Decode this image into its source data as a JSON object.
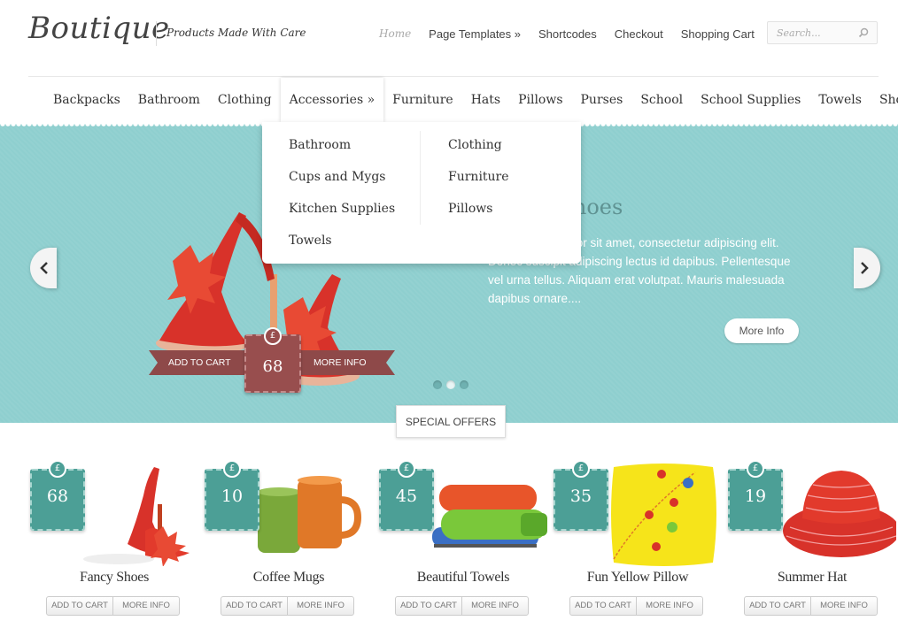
{
  "header": {
    "logo": "Boutique",
    "tagline": "Products Made With Care",
    "top_nav": [
      {
        "label": "Home",
        "active": true
      },
      {
        "label": "Page Templates »",
        "active": false
      },
      {
        "label": "Shortcodes",
        "active": false
      },
      {
        "label": "Checkout",
        "active": false
      },
      {
        "label": "Shopping Cart",
        "active": false
      }
    ],
    "search_placeholder": "Search..."
  },
  "categories": [
    "Backpacks",
    "Bathroom",
    "Clothing",
    "Accessories »",
    "Furniture",
    "Hats",
    "Pillows",
    "Purses",
    "School",
    "School Supplies",
    "Towels",
    "Shoes"
  ],
  "dropdown": {
    "column1": [
      "Bathroom",
      "Cups and Mygs",
      "Kitchen Supplies",
      "Towels"
    ],
    "column2": [
      "Clothing",
      "Furniture",
      "Pillows"
    ]
  },
  "hero": {
    "title": "Fancy Shoes",
    "text": "Lorem ipsum dolor sit amet, consectetur adipiscing elit. Donec suscipit adipiscing lectus id dapibus. Pellentesque vel urna tellus. Aliquam erat volutpat. Mauris malesuada dapibus ornare....",
    "more_info": "More Info",
    "add_to_cart": "ADD TO CART",
    "ribbon_more_info": "MORE INFO",
    "currency": "£",
    "price": "68",
    "slides": 3,
    "active_slide": 2
  },
  "special_offers_label": "SPECIAL OFFERS",
  "products": [
    {
      "name": "Fancy Shoes",
      "price": "68",
      "image": "red-heels"
    },
    {
      "name": "Coffee Mugs",
      "price": "10",
      "image": "mugs"
    },
    {
      "name": "Beautiful Towels",
      "price": "45",
      "image": "towels"
    },
    {
      "name": "Fun Yellow Pillow",
      "price": "35",
      "image": "yellow-pillow"
    },
    {
      "name": "Summer Hat",
      "price": "19",
      "image": "red-hat"
    }
  ],
  "product_buttons": {
    "add_to_cart": "ADD TO CART",
    "more_info": "MORE INFO"
  },
  "colors": {
    "accent_teal": "#8ecfcf",
    "tag_teal": "#4c9f96",
    "tag_red": "#984e4e",
    "ribbon_red": "#8e4949"
  }
}
